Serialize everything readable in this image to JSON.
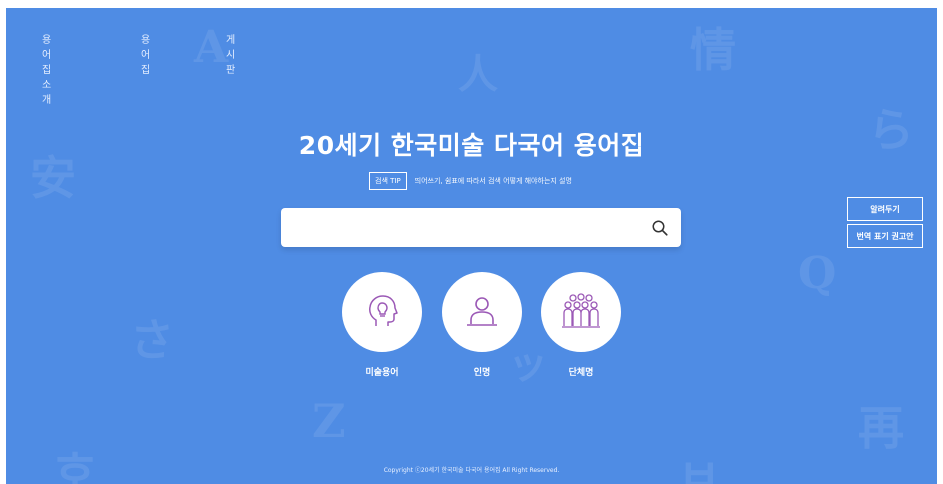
{
  "colors": {
    "background": "#4f8ce4",
    "accent": "#9b59b6"
  },
  "nav": {
    "items": [
      {
        "label": "용어집 소개"
      },
      {
        "label": "용어집"
      },
      {
        "label": "게시판"
      }
    ]
  },
  "hero": {
    "title": "20세기 한국미술 다국어 용어집",
    "tip_badge": "검색 TIP",
    "tip_text": "띄어쓰기, 쉼표에 따라서 검색 어떻게 해야하는지 설명"
  },
  "search": {
    "value": "",
    "placeholder": "",
    "icon": "search-icon"
  },
  "categories": [
    {
      "label": "미술용어",
      "icon": "head-lightbulb-icon"
    },
    {
      "label": "인명",
      "icon": "person-icon"
    },
    {
      "label": "단체명",
      "icon": "group-icon"
    }
  ],
  "side_buttons": {
    "notice": "알려두기",
    "translation": "번역 표기 권고안"
  },
  "footer": {
    "copyright": "Copyright ⓒ20세기 한국미술 다국어 용어집 All Right Reserved."
  }
}
